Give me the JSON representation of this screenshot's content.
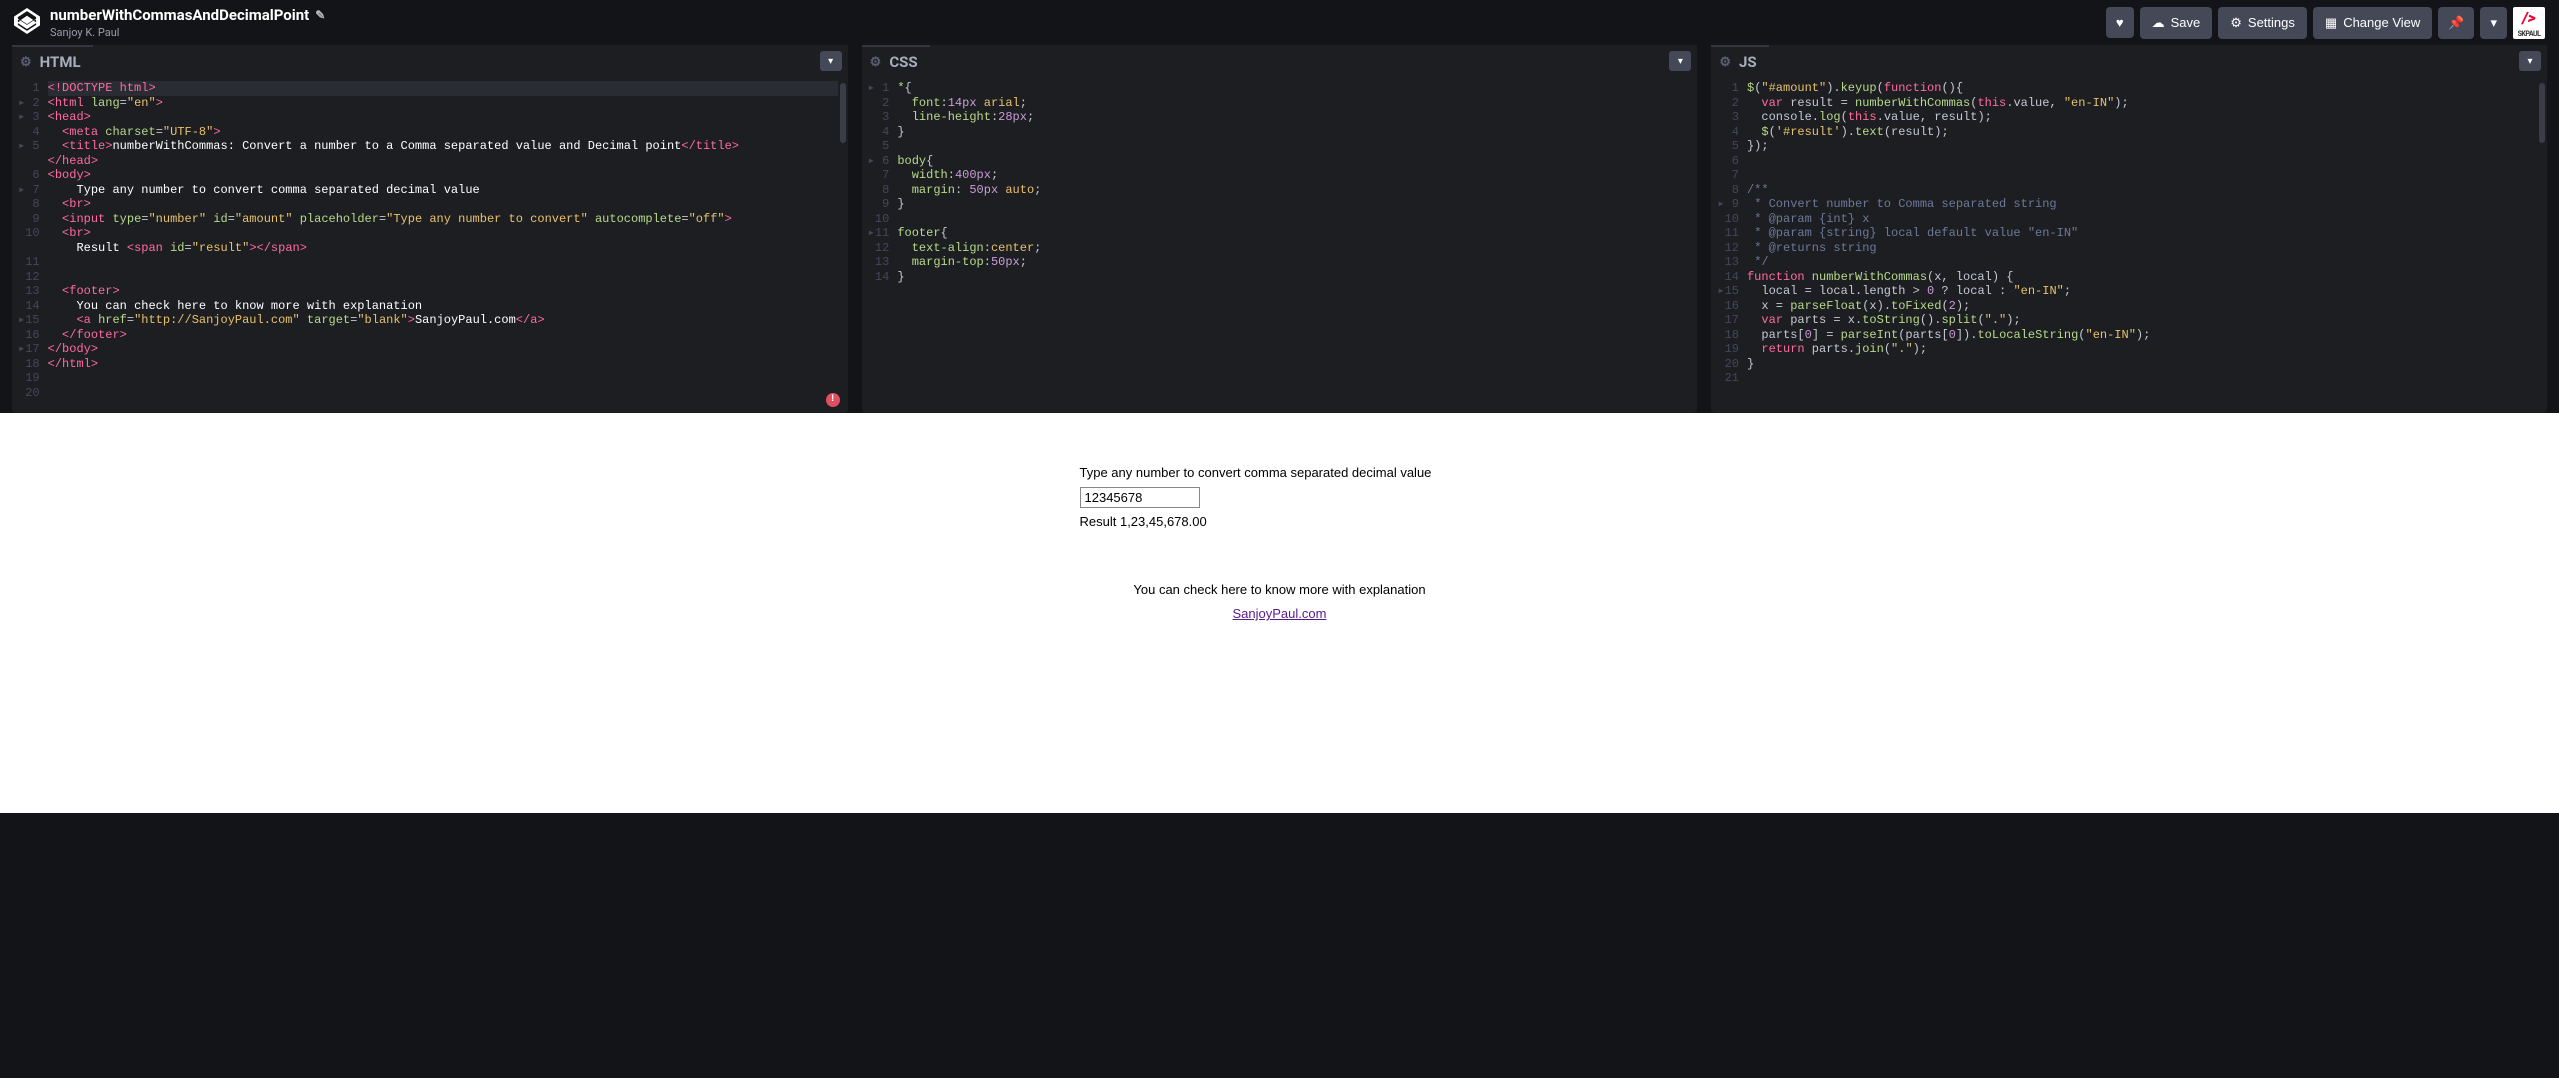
{
  "header": {
    "title": "numberWithCommasAndDecimalPoint",
    "author": "Sanjoy K. Paul",
    "buttons": {
      "save": "Save",
      "settings": "Settings",
      "changeView": "Change View"
    },
    "avatar_label": "SKPAUL"
  },
  "panels": {
    "html": {
      "title": "HTML"
    },
    "css": {
      "title": "CSS"
    },
    "js": {
      "title": "JS"
    }
  },
  "html_lines": [
    "1",
    "2",
    "3",
    "4",
    "5",
    "6",
    "7",
    "8",
    "9",
    "10",
    "11",
    "12",
    "13",
    "14",
    "15",
    "16",
    "17",
    "18",
    "19",
    "20"
  ],
  "css_lines": [
    "1",
    "2",
    "3",
    "4",
    "5",
    "6",
    "7",
    "8",
    "9",
    "10",
    "11",
    "12",
    "13",
    "14"
  ],
  "js_lines": [
    "1",
    "2",
    "3",
    "4",
    "5",
    "6",
    "7",
    "8",
    "9",
    "10",
    "11",
    "12",
    "13",
    "14",
    "15",
    "16",
    "17",
    "18",
    "19",
    "20",
    "21"
  ],
  "html_code": {
    "l1": "<!DOCTYPE html>",
    "l2": "<html lang=\"en\">",
    "l3": "<head>",
    "l4": "  <meta charset=\"UTF-8\">",
    "l5_a": "  <title>",
    "l5_b": "numberWithCommas: Convert a number to a Comma separated value and Decimal point",
    "l5_c": "</title>",
    "l6": "</head>",
    "l7": "<body>",
    "l8": "    Type any number to convert comma separated decimal value",
    "l9": "  <br>",
    "l10": "  <input type=\"number\" id=\"amount\" placeholder=\"Type any number to convert\" autocomplete=\"off\">",
    "l11": "  <br>",
    "l12_a": "    Result ",
    "l12_b": "<span id=\"result\"></span>",
    "l15": "  <footer>",
    "l16": "    You can check here to know more with explanation",
    "l17_a": "    <a href=\"http://SanjoyPaul.com\" target=\"blank\">",
    "l17_b": "SanjoyPaul.com",
    "l17_c": "</a>",
    "l18": "  </footer>",
    "l19": "</body>",
    "l20": "</html>"
  },
  "css_code": {
    "l1": "*{",
    "l2": "  font:14px arial;",
    "l3": "  line-height:28px;",
    "l4": "}",
    "l6": "body{",
    "l7": "  width:400px;",
    "l8": "  margin: 50px auto;",
    "l9": "}",
    "l11": "footer{",
    "l12": "  text-align:center;",
    "l13": "  margin-top:50px;",
    "l14": "}"
  },
  "js_code": {
    "l1": "$(\"#amount\").keyup(function(){",
    "l2": "  var result = numberWithCommas(this.value, \"en-IN\");",
    "l3": "  console.log(this.value, result);",
    "l4": "  $('#result').text(result);",
    "l5": "});",
    "l8": "/**",
    "l9": " * Convert number to Comma separated string",
    "l10": " * @param {int} x",
    "l11": " * @param {string} local default value \"en-IN\"",
    "l12": " * @returns string",
    "l13": " */",
    "l14": "function numberWithCommas(x, local) {",
    "l15": "  local = local.length > 0 ? local : \"en-IN\";",
    "l16": "  x = parseFloat(x).toFixed(2);",
    "l17": "  var parts = x.toString().split(\".\");",
    "l18": "  parts[0] = parseInt(parts[0]).toLocaleString(\"en-IN\");",
    "l19": "  return parts.join(\".\");",
    "l20": "}"
  },
  "output": {
    "prompt": "Type any number to convert comma separated decimal value",
    "input_value": "12345678",
    "input_placeholder": "Type any number to convert",
    "result_label": "Result ",
    "result_value": "1,23,45,678.00",
    "footer_text": "You can check here to know more with explanation",
    "footer_link": "SanjoyPaul.com"
  }
}
